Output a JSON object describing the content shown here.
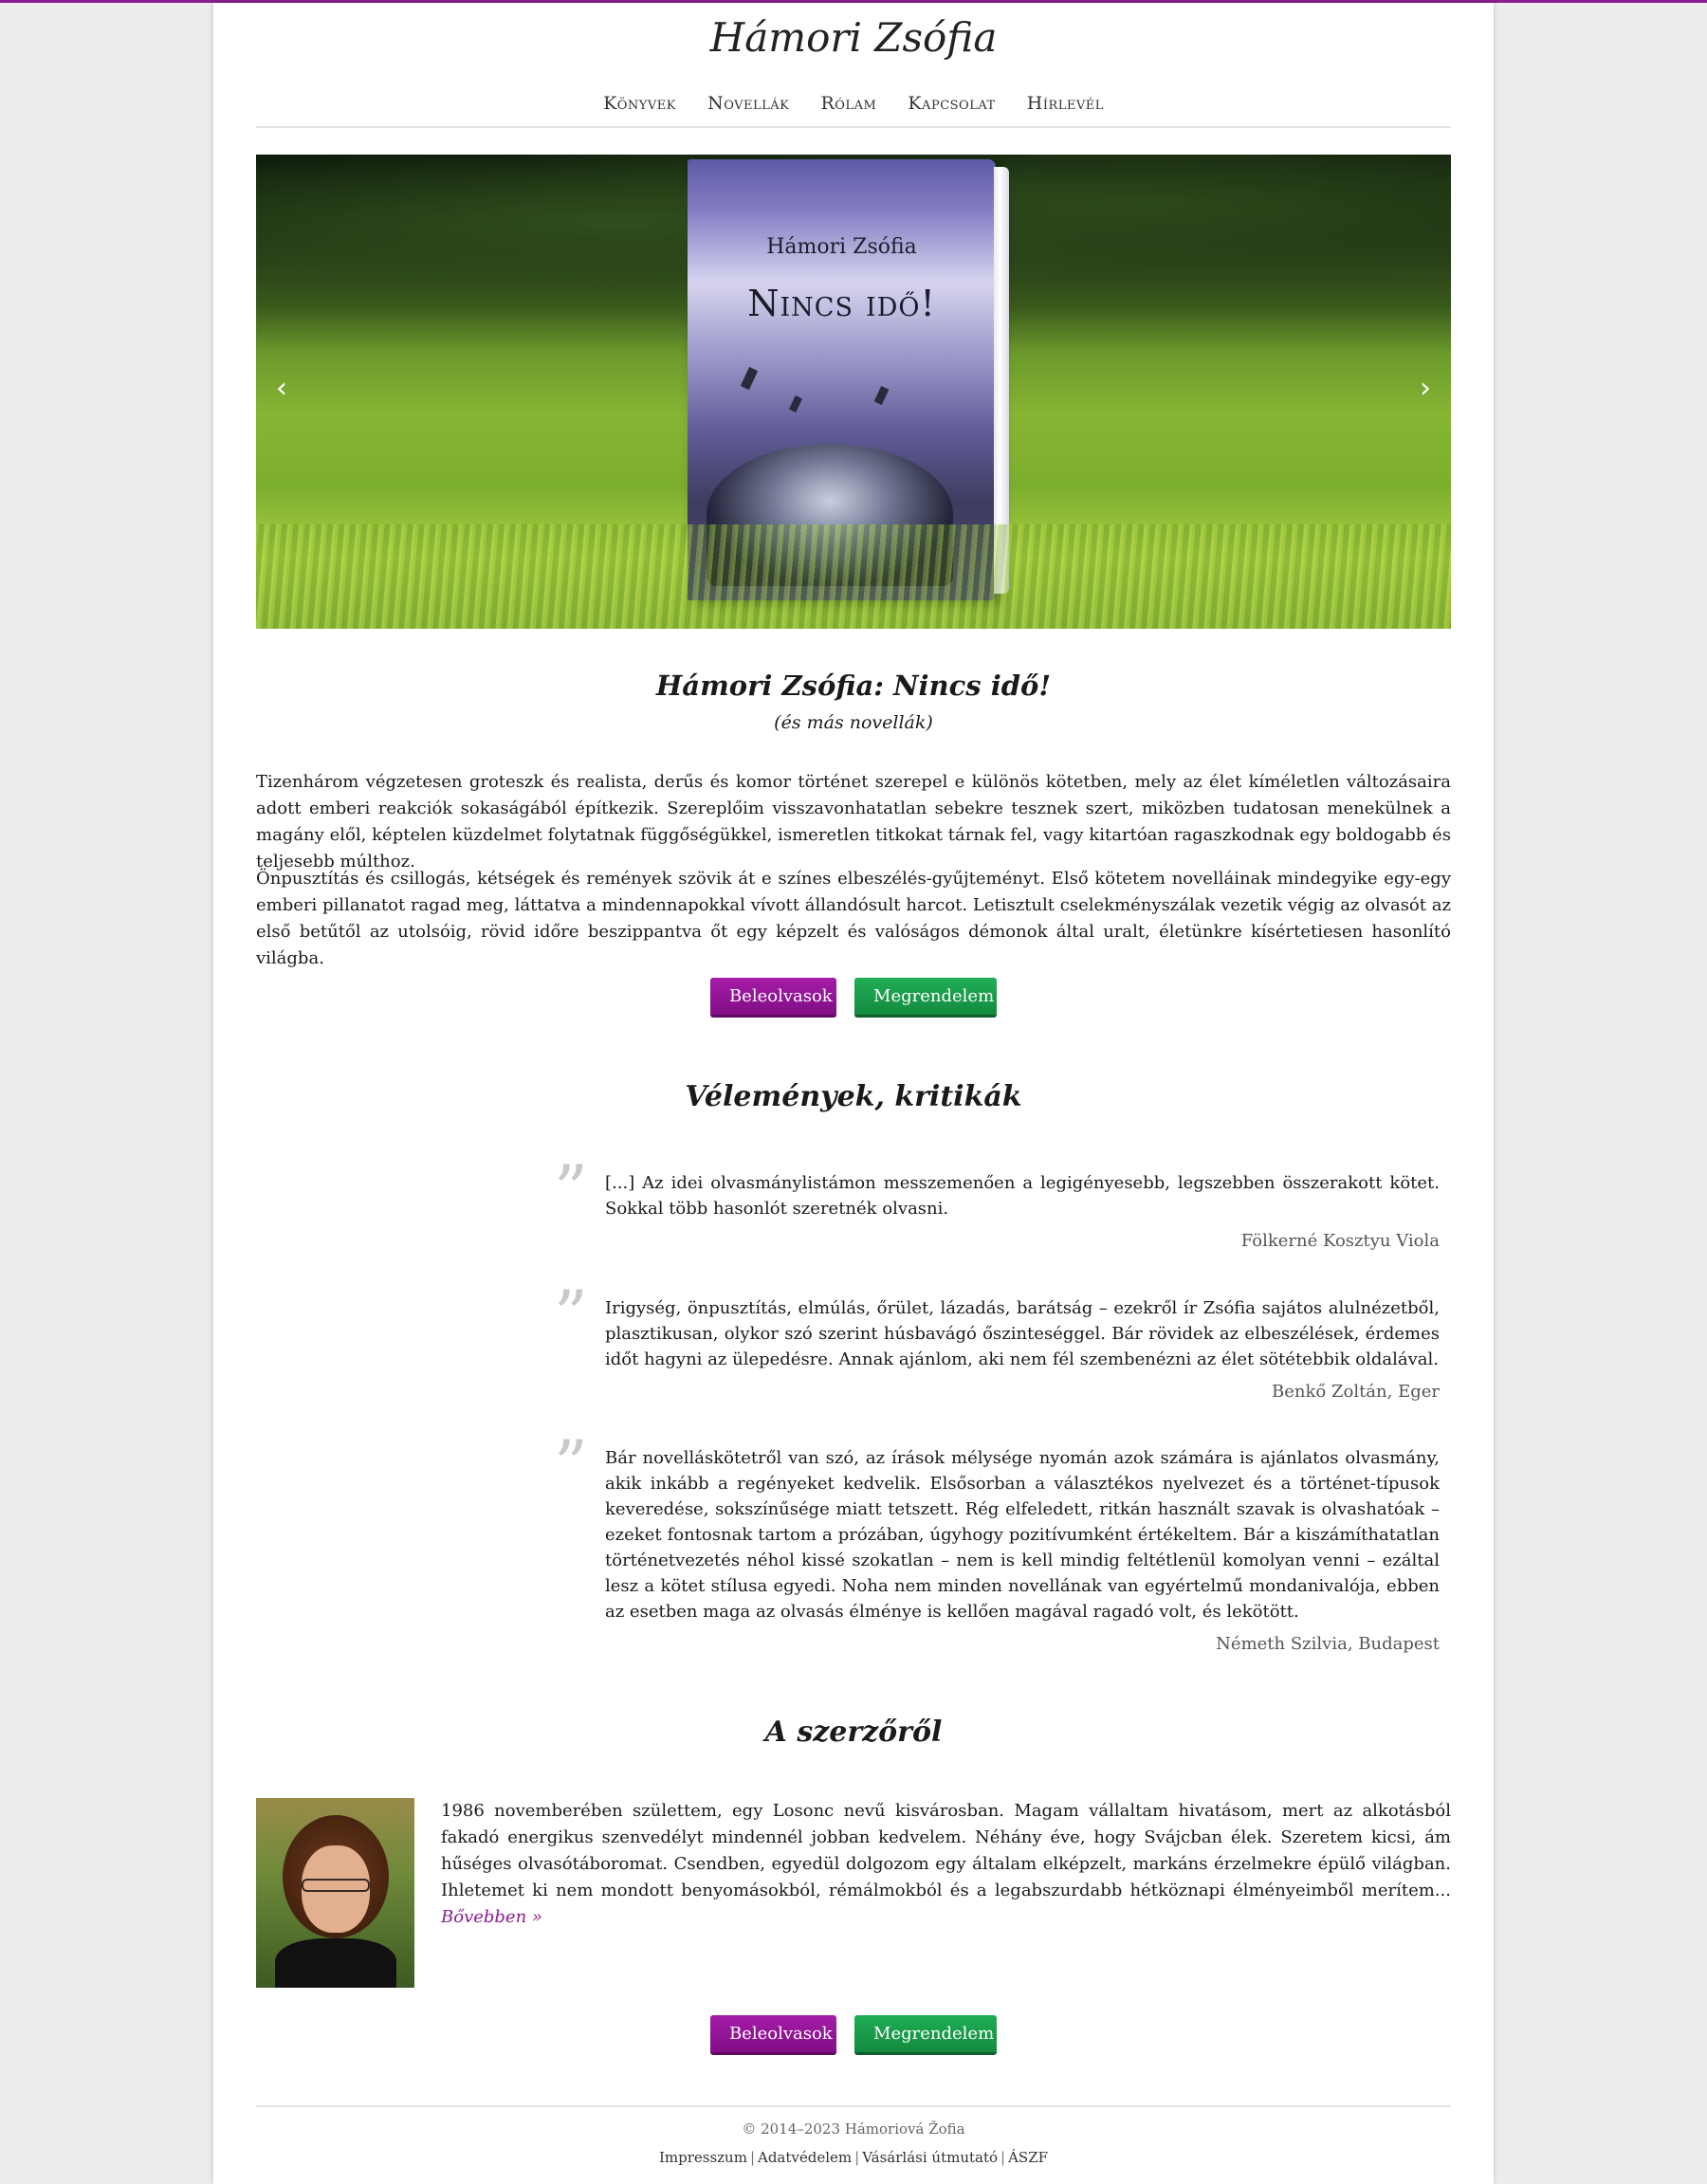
{
  "site": {
    "title": "Hámori Zsófia"
  },
  "nav": {
    "items": [
      "Könyvek",
      "Novellák",
      "Rólam",
      "Kapcsolat",
      "Hírlevél"
    ]
  },
  "hero": {
    "book_author": "Hámori Zsófia",
    "book_title": "Nincs idő!",
    "prev_icon": "‹",
    "next_icon": "›"
  },
  "book": {
    "heading": "Hámori Zsófia: Nincs idő!",
    "subheading": "(és más novellák)",
    "paragraphs": [
      "Tizenhárom végzetesen groteszk és realista, derűs és komor történet szerepel e különös kötetben, mely az élet kíméletlen változásaira adott emberi reakciók sokaságából építkezik. Szereplőim visszavonhatatlan sebekre tesznek szert, miközben tudatosan menekülnek a magány elől, képtelen küzdelmet folytatnak függőségükkel, ismeretlen titkokat tárnak fel, vagy kitartóan ragaszkodnak egy boldogabb és teljesebb múlthoz.",
      "Önpusztítás és csillogás, kétségek és remények szövik át e színes elbeszélés-gyűjteményt. Első kötetem novelláinak mindegyike egy-egy emberi pillanatot ragad meg, láttatva a mindennapokkal vívott állandósult harcot. Letisztult cselekményszálak vezetik végig az olvasót az első betűtől az utolsóig, rövid időre beszippantva őt egy képzelt és valóságos démonok által uralt, életünkre kísértetiesen hasonlító világba."
    ]
  },
  "buttons": {
    "read": "Beleolvasok",
    "order": "Megrendelem"
  },
  "reviews": {
    "heading": "Vélemények, kritikák",
    "items": [
      {
        "text": "[...] Az idei olvasmánylistámon messzemenően a legigényesebb, legszebben összerakott kötet. Sokkal több hasonlót szeretnék olvasni.",
        "author": "Fölkerné Kosztyu Viola"
      },
      {
        "text": "Irigység, önpusztítás, elmúlás, őrület, lázadás, barátság – ezekről ír Zsófia sajátos alulnézetből, plasztikusan, olykor szó szerint húsbavágó őszinteséggel. Bár rövidek az elbeszélések, érdemes időt hagyni az ülepedésre. Annak ajánlom, aki nem fél szembenézni az élet sötétebbik oldalával.",
        "author": "Benkő Zoltán, Eger"
      },
      {
        "text": "Bár novelláskötetről van szó, az írások mélysége nyomán azok számára is ajánlatos olvasmány, akik inkább a regényeket kedvelik. Elsősorban a választékos nyelvezet és a történet-típusok keveredése, sokszínűsége miatt tetszett. Rég elfeledett, ritkán használt szavak is olvashatóak – ezeket fontosnak tartom a prózában, úgyhogy pozitívumként értékeltem. Bár a kiszámíthatatlan történetvezetés néhol kissé szokatlan – nem is kell mindig feltétlenül komolyan venni – ezáltal lesz a kötet stílusa egyedi. Noha nem minden novellának van egyértelmű mondanivalója, ebben az esetben maga az olvasás élménye is kellően magával ragadó volt, és lekötött.",
        "author": "Németh Szilvia, Budapest"
      }
    ],
    "quote_mark": "”"
  },
  "about": {
    "heading": "A szerzőről",
    "text": "1986 novemberében születtem, egy Losonc nevű kisvárosban. Magam vállaltam hivatásom, mert az alkotásból fakadó energikus szenvedélyt mindennél jobban kedvelem. Néhány éve, hogy Svájcban élek. Szeretem kicsi, ám hűséges olvasótáboromat. Csendben, egyedül dolgozom egy általam elképzelt, markáns érzelmekre épülő világban. Ihletemet ki nem mondott benyomásokból, rémálmokból és a legabszurdabb hétköznapi élményeimből merítem...",
    "more_link": "Bővebben »"
  },
  "footer": {
    "copyright": "© 2014–2023 Hámoriová Žofia",
    "links": [
      "Impresszum",
      "Adatvédelem",
      "Vásárlási útmutató",
      "ÁSZF"
    ]
  },
  "colors": {
    "accent": "#8b1e8e",
    "order_green": "#1a9e4b"
  }
}
